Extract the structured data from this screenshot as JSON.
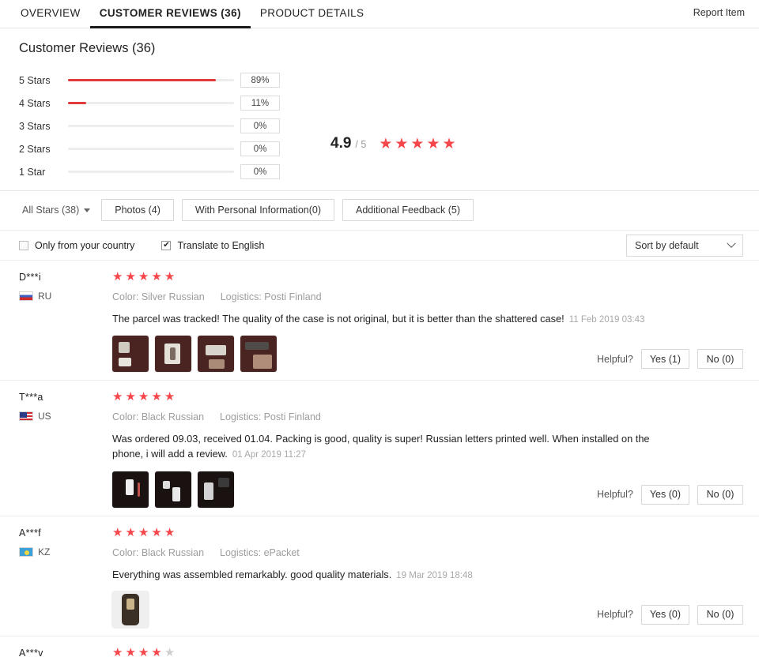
{
  "header": {
    "tabs": [
      {
        "label": "OVERVIEW",
        "active": false
      },
      {
        "label": "CUSTOMER REVIEWS (36)",
        "active": true
      },
      {
        "label": "PRODUCT DETAILS",
        "active": false
      }
    ],
    "report_label": "Report Item"
  },
  "summary": {
    "title": "Customer Reviews (36)",
    "overall_score": "4.9",
    "overall_of": "/ 5",
    "overall_stars": 5,
    "breakdown": [
      {
        "label": "5 Stars",
        "percent_label": "89%",
        "percent": 89
      },
      {
        "label": "4 Stars",
        "percent_label": "11%",
        "percent": 11
      },
      {
        "label": "3 Stars",
        "percent_label": "0%",
        "percent": 0
      },
      {
        "label": "2 Stars",
        "percent_label": "0%",
        "percent": 0
      },
      {
        "label": "1 Star",
        "percent_label": "0%",
        "percent": 0
      }
    ]
  },
  "filters": {
    "all_stars_label": "All Stars (38)",
    "chips": [
      {
        "label": "Photos (4)"
      },
      {
        "label": "With Personal Information(0)"
      },
      {
        "label": "Additional Feedback (5)"
      }
    ]
  },
  "options": {
    "only_country_label": "Only from your country",
    "only_country_checked": false,
    "translate_label": "Translate to English",
    "translate_checked": true,
    "translate_check_glyph": "✔",
    "sort_label": "Sort by default"
  },
  "labels": {
    "helpful": "Helpful?",
    "color_prefix": "Color:",
    "logistics_prefix": "Logistics:"
  },
  "reviews": [
    {
      "user": "D***i",
      "country": "RU",
      "flag_class": "flag-ru",
      "stars": 5,
      "color": "Color: Silver Russian",
      "logistics": "Logistics: Posti Finland",
      "text": "The parcel was tracked! The quality of the case is not original, but it is better than the shattered case!",
      "date": "11 Feb 2019 03:43",
      "thumbs": 4,
      "thumb_style": "brown",
      "yes_label": "Yes (1)",
      "no_label": "No (0)"
    },
    {
      "user": "T***a",
      "country": "US",
      "flag_class": "flag-us",
      "stars": 5,
      "color": "Color: Black Russian",
      "logistics": "Logistics: Posti Finland",
      "text": "Was ordered 09.03, received 01.04. Packing is good, quality is super! Russian letters printed well. When installed on the phone, i will add a review.",
      "date": "01 Apr 2019 11:27",
      "thumbs": 3,
      "thumb_style": "dark",
      "yes_label": "Yes (0)",
      "no_label": "No (0)"
    },
    {
      "user": "A***f",
      "country": "KZ",
      "flag_class": "flag-kz",
      "stars": 5,
      "color": "Color: Black Russian",
      "logistics": "Logistics: ePacket",
      "text": "Everything was assembled remarkably. good quality materials.",
      "date": "19 Mar 2019 18:48",
      "thumbs": 1,
      "thumb_style": "light",
      "yes_label": "Yes (0)",
      "no_label": "No (0)"
    },
    {
      "user": "A***v",
      "country": "",
      "flag_class": "",
      "stars": 4,
      "color": "",
      "logistics": "",
      "text": "",
      "date": "",
      "thumbs": 0,
      "thumb_style": "",
      "yes_label": "",
      "no_label": ""
    }
  ],
  "colors": {
    "star_on": "#f5474b",
    "star_off": "#cfcfcf",
    "bar_fill": "#e0393e",
    "active_tab_underline": "#191919"
  }
}
